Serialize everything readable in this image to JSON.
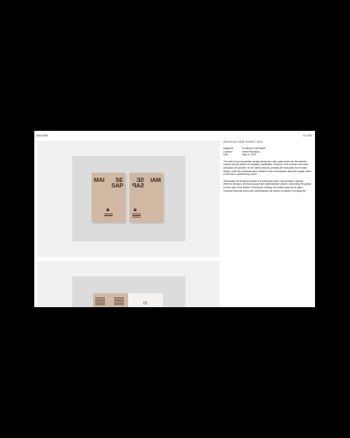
{
  "header": {
    "brand": "MAZOME",
    "close_label": "CLOSE"
  },
  "gallery": {
    "cover_title_left": "SE\nSAP",
    "cover_title_right": "MAI",
    "cover_title_left_b": "MAI",
    "cover_title_right_b": "SE\nSAP"
  },
  "info": {
    "title": "ARCHITECTURE DIGEST 2023",
    "meta": [
      {
        "key": "Magazine",
        "value": "Foodhall & City Market"
      },
      {
        "key": "Location",
        "value": "Saint Petersburg"
      },
      {
        "key": "Date",
        "value": "May 11, 2023"
      }
    ],
    "paragraph_1": "The work of any dog shelter usually follows two main goals which are the animal's comfort and the search for adoption possibilities. However, both of these aims often contradict one another: for the safety reasons, animals are kept away from human beings, while the understanding of shelter's inner mechanisms helps the regular visitor to become a potential dog owner.",
    "paragraph_2": "Structurally, the building consists of 6 functional blocks: dog enclosed, aviaries, veterinar sections, technical support and administrative volume, welcoming the guests on their way to the shelter. Entering the building, the visitors pass by the glass enclosed technical area which demonstrates the scenes of shelter's everyday life."
  }
}
